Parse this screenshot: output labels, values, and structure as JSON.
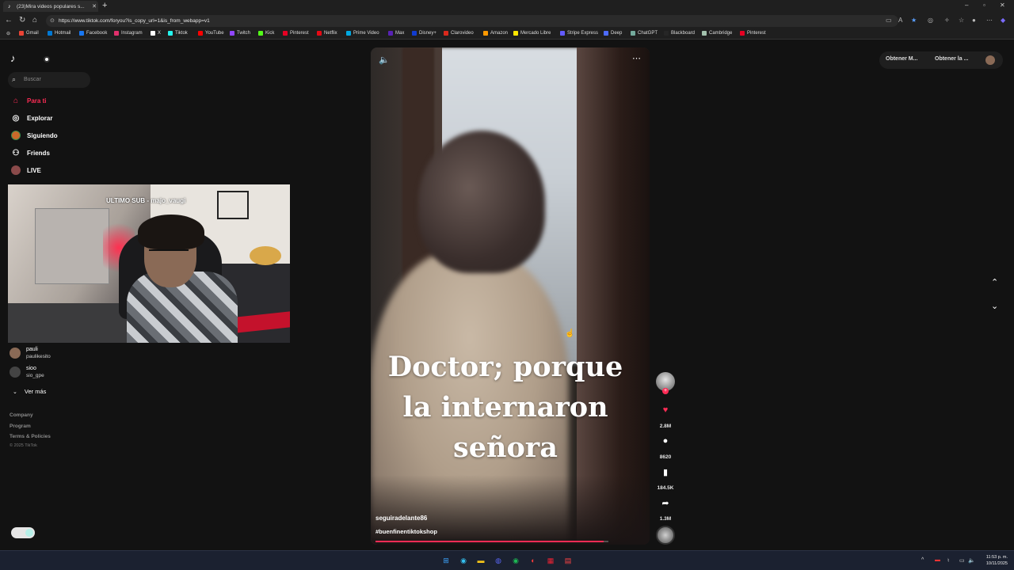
{
  "browser": {
    "tab_title": "(23)Mira videos populares s...",
    "url": "https://www.tiktok.com/foryou?is_copy_url=1&is_from_webapp=v1",
    "bookmarks": [
      {
        "label": "Gmail",
        "color": "#ea4335"
      },
      {
        "label": "Hotmail",
        "color": "#0078d4"
      },
      {
        "label": "Facebook",
        "color": "#1877f2"
      },
      {
        "label": "Instagram",
        "color": "#e1306c"
      },
      {
        "label": "X",
        "color": "#ffffff"
      },
      {
        "label": "Tiktok",
        "color": "#25f4ee"
      },
      {
        "label": "YouTube",
        "color": "#ff0000"
      },
      {
        "label": "Twitch",
        "color": "#9146ff"
      },
      {
        "label": "Kick",
        "color": "#53fc18"
      },
      {
        "label": "Pinterest",
        "color": "#e60023"
      },
      {
        "label": "Netflix",
        "color": "#e50914"
      },
      {
        "label": "Prime Video",
        "color": "#00a8e1"
      },
      {
        "label": "Max",
        "color": "#5822b4"
      },
      {
        "label": "Disney+",
        "color": "#113ccf"
      },
      {
        "label": "Clarovideo",
        "color": "#da291c"
      },
      {
        "label": "Amazon",
        "color": "#ff9900"
      },
      {
        "label": "Mercado Libre",
        "color": "#ffe600"
      },
      {
        "label": "Stripe Express",
        "color": "#635bff"
      },
      {
        "label": "Deep",
        "color": "#4d6bfe"
      },
      {
        "label": "ChatGPT",
        "color": "#74aa9c"
      },
      {
        "label": "Blackboard",
        "color": "#262626"
      },
      {
        "label": "Cambridge",
        "color": "#a3c1ad"
      },
      {
        "label": "Pinterest",
        "color": "#e60023"
      }
    ]
  },
  "sidebar": {
    "search_placeholder": "Buscar",
    "nav": [
      {
        "label": "Para ti",
        "icon": "home-icon",
        "active": true
      },
      {
        "label": "Explorar",
        "icon": "compass-icon"
      },
      {
        "label": "Siguiendo",
        "icon": "following-avatar-icon"
      },
      {
        "label": "Friends",
        "icon": "friends-icon"
      },
      {
        "label": "LIVE",
        "icon": "live-icon"
      }
    ],
    "webcam_overlay": "ULTIMO SUB - majo_vaugi",
    "following": [
      {
        "name": "pauli",
        "handle": "paulikesito"
      },
      {
        "name": "sioo",
        "handle": "sio_gpe"
      }
    ],
    "see_more": "Ver más",
    "footer": [
      "Company",
      "Program",
      "Terms & Policies"
    ],
    "copyright": "© 2025 TikTok"
  },
  "video": {
    "caption_lines": [
      "Doctor; porque",
      "la internaron",
      "señora"
    ],
    "author": "seguiradelante86",
    "hashtag": "#buenfinentiktokshop",
    "progress": 0.98
  },
  "actions": {
    "likes": "2.8M",
    "comments": "8620",
    "saves": "184.5K",
    "shares": "1.3M"
  },
  "top_right": {
    "get_app_1": "Obtener M...",
    "get_app_2": "Obtener la ..."
  },
  "system": {
    "time": "11:53 p. m.",
    "date": "10/11/2025"
  },
  "colors": {
    "accent": "#fe2c55",
    "background": "#121212"
  }
}
